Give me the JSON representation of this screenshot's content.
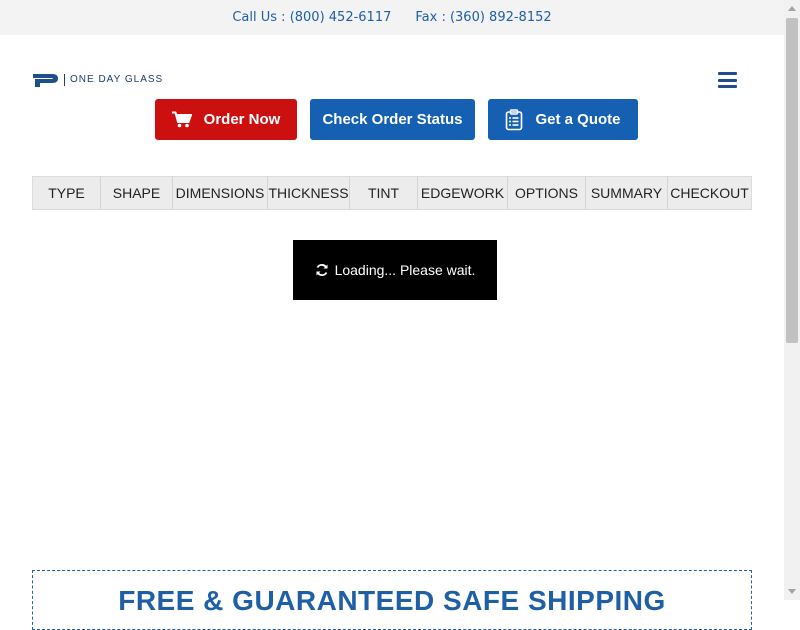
{
  "topbar": {
    "call": "Call Us : (800) 452-6117",
    "fax": "Fax : (360) 892-8152"
  },
  "brand": {
    "name": "ONE DAY GLASS"
  },
  "colors": {
    "brand_blue": "#1560b3",
    "order_red": "#cc1010",
    "text_blue": "#1f5fa6"
  },
  "actions": {
    "order_now": "Order Now",
    "check_status": "Check Order Status",
    "get_quote": "Get a Quote"
  },
  "icons": {
    "order_now": "shopping-cart-icon",
    "get_quote": "clipboard-list-icon",
    "menu": "hamburger-menu-icon",
    "loading": "refresh-icon"
  },
  "steps": [
    "TYPE",
    "SHAPE",
    "DIMENSIONS",
    "THICKNESS",
    "TINT",
    "EDGEWORK",
    "OPTIONS",
    "SUMMARY",
    "CHECKOUT"
  ],
  "loading": {
    "text": "Loading... Please wait."
  },
  "shipping": {
    "title": "FREE & GUARANTEED SAFE SHIPPING"
  }
}
